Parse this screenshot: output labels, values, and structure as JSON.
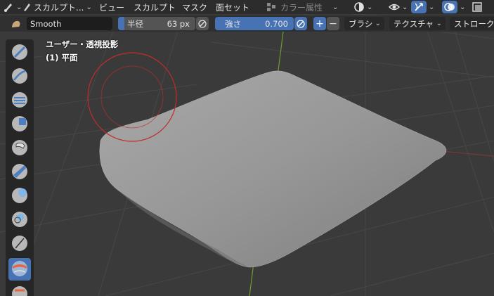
{
  "header": {
    "mode_label": "スカルプト...",
    "menu": [
      "ビュー",
      "スカルプト",
      "マスク",
      "面セット"
    ],
    "color_attribute_label": "カラー属性"
  },
  "tool_settings": {
    "brush_name": "Smooth",
    "radius_label": "半径",
    "radius_value": "63 px",
    "strength_label": "強さ",
    "strength_value": "0.700",
    "plus_label": "+",
    "minus_label": "−",
    "brush_menu": "ブラシ",
    "texture_menu": "テクスチャ",
    "stroke_menu": "ストローク"
  },
  "viewport": {
    "view_label": "ユーザー・透視投影",
    "object_label": "(1) 平面"
  },
  "tools": [
    {
      "name": "draw-brush-icon",
      "active": false
    },
    {
      "name": "draw-sharp-brush-icon",
      "active": false
    },
    {
      "name": "clay-brush-icon",
      "active": false
    },
    {
      "name": "clay-strips-brush-icon",
      "active": false
    },
    {
      "name": "clay-thumb-brush-icon",
      "active": false
    },
    {
      "name": "layer-brush-icon",
      "active": false
    },
    {
      "name": "inflate-brush-icon",
      "active": false
    },
    {
      "name": "blob-brush-icon",
      "active": false
    },
    {
      "name": "crease-brush-icon",
      "active": false
    },
    {
      "name": "smooth-brush-icon",
      "active": true
    },
    {
      "name": "flatten-brush-icon",
      "active": false
    }
  ],
  "colors": {
    "accent": "#4772b3",
    "brush_circle": "#c42b2b",
    "header_bg": "#2c2c2c",
    "viewport_bg": "#393939"
  }
}
